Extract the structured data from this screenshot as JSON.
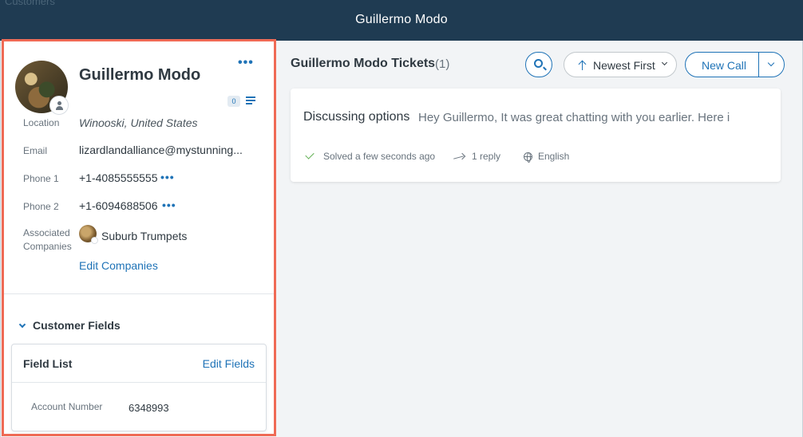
{
  "window": {
    "ghost_title": "Customers",
    "title": "Guillermo Modo"
  },
  "profile": {
    "name": "Guillermo Modo",
    "more_label": "•••",
    "badge_count": "0",
    "fields": {
      "location_label": "Location",
      "location_value": "Winooski, United States",
      "email_label": "Email",
      "email_value": "lizardlandalliance@mystunning...",
      "phone1_label": "Phone 1",
      "phone1_value": "+1-4085555555",
      "phone2_label": "Phone 2",
      "phone2_value": "+1-6094688506",
      "companies_label_line1": "Associated",
      "companies_label_line2": "Companies",
      "company_name": "Suburb Trumpets",
      "edit_companies": "Edit Companies"
    },
    "inline_dots": "•••"
  },
  "customer_fields": {
    "section_title": "Customer Fields",
    "card_title": "Field List",
    "edit_label": "Edit Fields",
    "account_number_label": "Account Number",
    "account_number_value": "6348993"
  },
  "tickets": {
    "title": "Guillermo Modo Tickets",
    "count": "(1)",
    "sort_label": "Newest First",
    "new_call_label": "New Call",
    "items": [
      {
        "subject": "Discussing options",
        "preview": "Hey Guillermo, It was great chatting with you earlier. Here i",
        "status": "Solved a few seconds ago",
        "replies": "1 reply",
        "language": "English"
      }
    ]
  },
  "colors": {
    "titlebar": "#1f3b52",
    "accent": "#1f73b7",
    "highlight_border": "#ef6a55",
    "success": "#5eae50"
  }
}
